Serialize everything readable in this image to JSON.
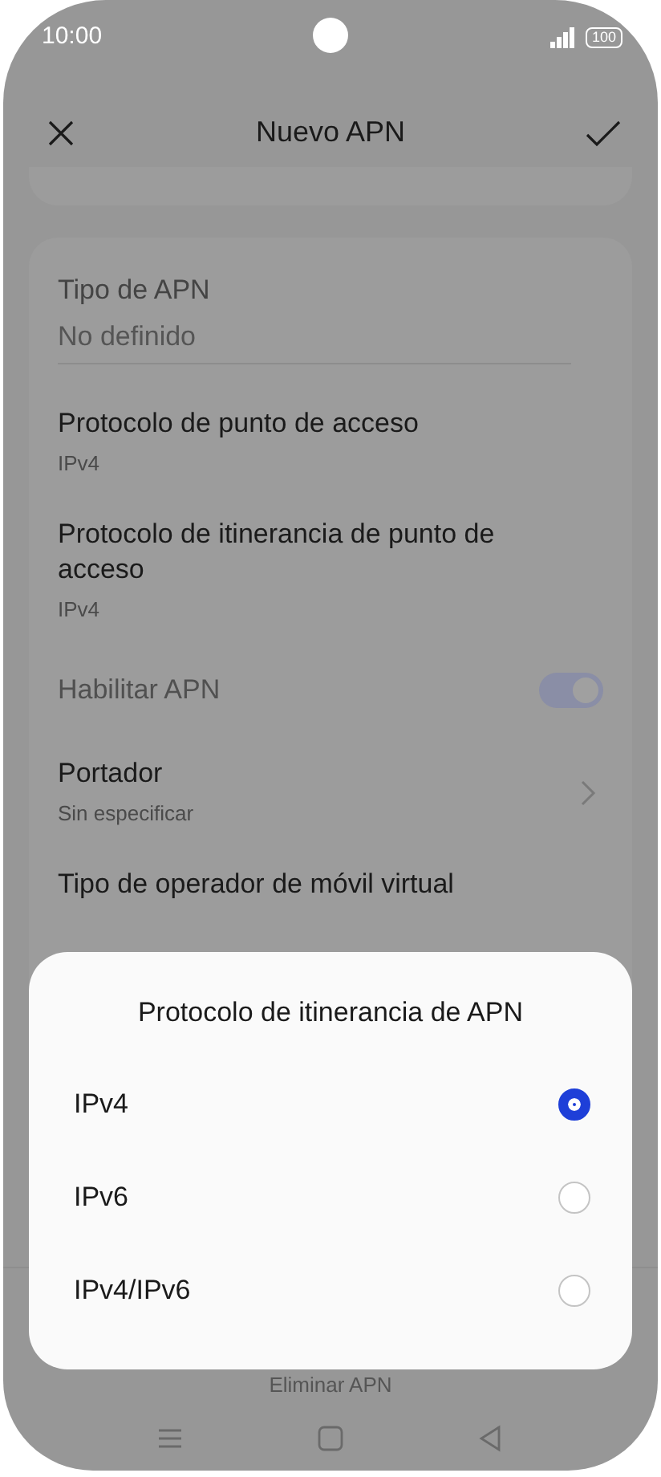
{
  "status_bar": {
    "time": "10:00",
    "battery": "100"
  },
  "header": {
    "title": "Nuevo APN"
  },
  "fields": [
    {
      "kind": "input",
      "label": "Tipo de APN",
      "placeholder": "No definido"
    },
    {
      "kind": "value",
      "title": "Protocolo de punto de acceso",
      "subtitle": "IPv4"
    },
    {
      "kind": "value",
      "title": "Protocolo de itinerancia de punto de acceso",
      "subtitle": "IPv4"
    },
    {
      "kind": "toggle",
      "title": "Habilitar APN",
      "disabled": true,
      "on": true
    },
    {
      "kind": "link",
      "title": "Portador",
      "subtitle": "Sin especificar"
    },
    {
      "kind": "value",
      "title": "Tipo de operador de móvil virtual"
    }
  ],
  "delete_button": "Eliminar APN",
  "dialog": {
    "title": "Protocolo de itinerancia de APN",
    "options": [
      {
        "label": "IPv4",
        "selected": true
      },
      {
        "label": "IPv6",
        "selected": false
      },
      {
        "label": "IPv4/IPv6",
        "selected": false
      }
    ]
  }
}
